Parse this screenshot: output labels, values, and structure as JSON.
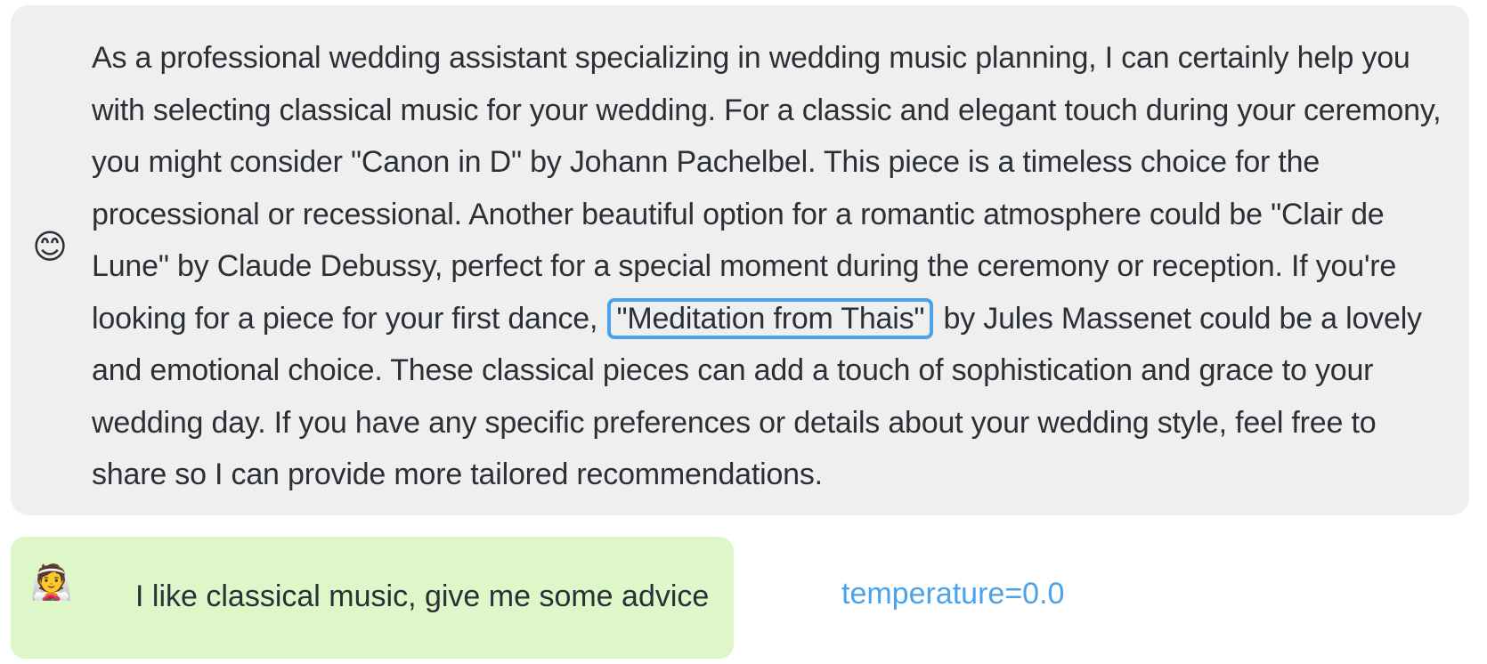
{
  "assistant": {
    "avatar_icon": "😊",
    "text_before": "As a professional wedding assistant specializing in wedding music planning, I can certainly help you with selecting classical music for your wedding. For a classic and elegant touch during your ceremony, you might consider \"Canon in D\" by Johann Pachelbel. This piece is a timeless choice for the processional or recessional. Another beautiful option for a romantic atmosphere could be \"Clair de Lune\" by Claude Debussy, perfect for a special moment during the ceremony or reception. If you're looking for a piece for your first dance,",
    "highlight": "\"Meditation from Thais\"",
    "text_after": "by Jules Massenet could be a lovely and emotional choice. These classical pieces can add a touch of sophistication and grace to your wedding day. If you have any specific preferences or details about your wedding style, feel free to share so I can provide more tailored recommendations."
  },
  "user": {
    "avatar_icon": "👰",
    "text": "I like classical music, give me some advice"
  },
  "temperature_label": "temperature=0.0",
  "colors": {
    "assistant_bubble": "#efefef",
    "user_bubble": "#def7c8",
    "accent": "#4aa3ea"
  }
}
